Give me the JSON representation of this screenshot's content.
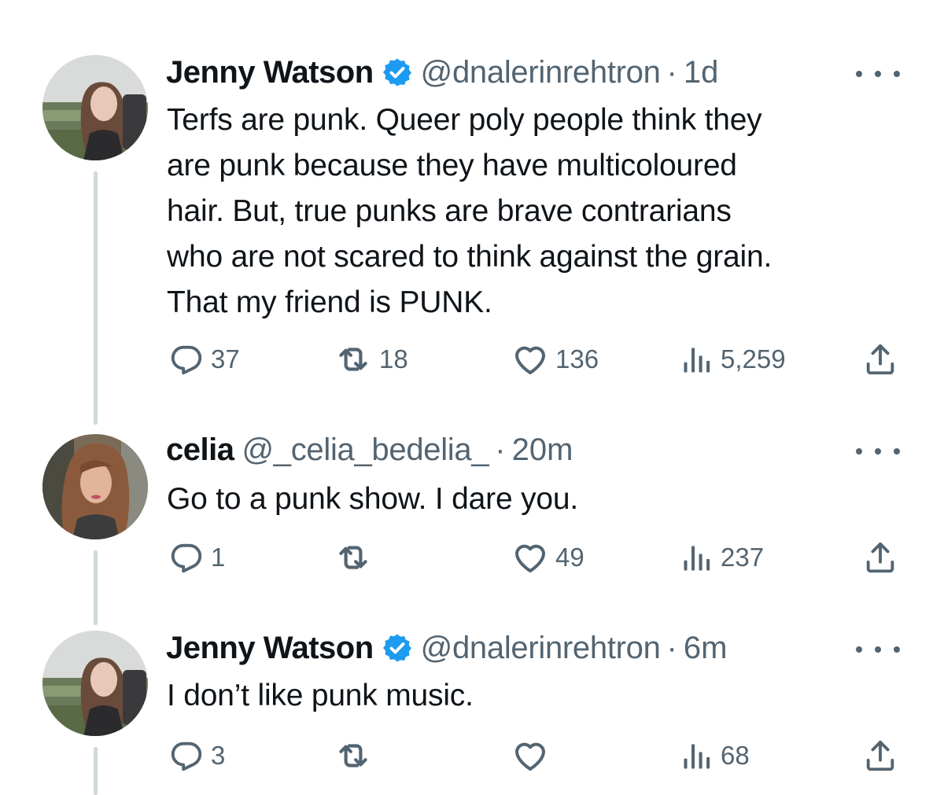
{
  "colors": {
    "text_primary": "#0f1419",
    "text_secondary": "#536471",
    "verified_blue": "#1d9bf0",
    "thread_line": "#cfd9de"
  },
  "tweets": [
    {
      "author": "Jenny Watson",
      "verified": true,
      "handle": "@dnalerinrehtron",
      "separator": "·",
      "time": "1d",
      "lines": [
        "Terfs are punk. Queer poly people think they",
        "are punk because they have multicoloured",
        "hair. But, true punks are brave contrarians",
        "who are not scared to think against the grain.",
        "That my friend is PUNK."
      ],
      "replies": "37",
      "reposts": "18",
      "likes": "136",
      "views": "5,259"
    },
    {
      "author": "celia",
      "verified": false,
      "handle": "@_celia_bedelia_",
      "separator": "·",
      "time": "20m",
      "lines": [
        "Go to a punk show. I dare you."
      ],
      "replies": "1",
      "reposts": "",
      "likes": "49",
      "views": "237"
    },
    {
      "author": "Jenny Watson",
      "verified": true,
      "handle": "@dnalerinrehtron",
      "separator": "·",
      "time": "6m",
      "lines": [
        "I don’t like punk music."
      ],
      "replies": "3",
      "reposts": "",
      "likes": "",
      "views": "68"
    }
  ],
  "icons": {
    "more": "more-horizontal-icon",
    "reply": "reply-bubble-icon",
    "repost": "repost-arrows-icon",
    "like": "heart-icon",
    "views": "bar-chart-icon",
    "share": "share-upload-icon",
    "verified": "verified-badge-icon"
  }
}
